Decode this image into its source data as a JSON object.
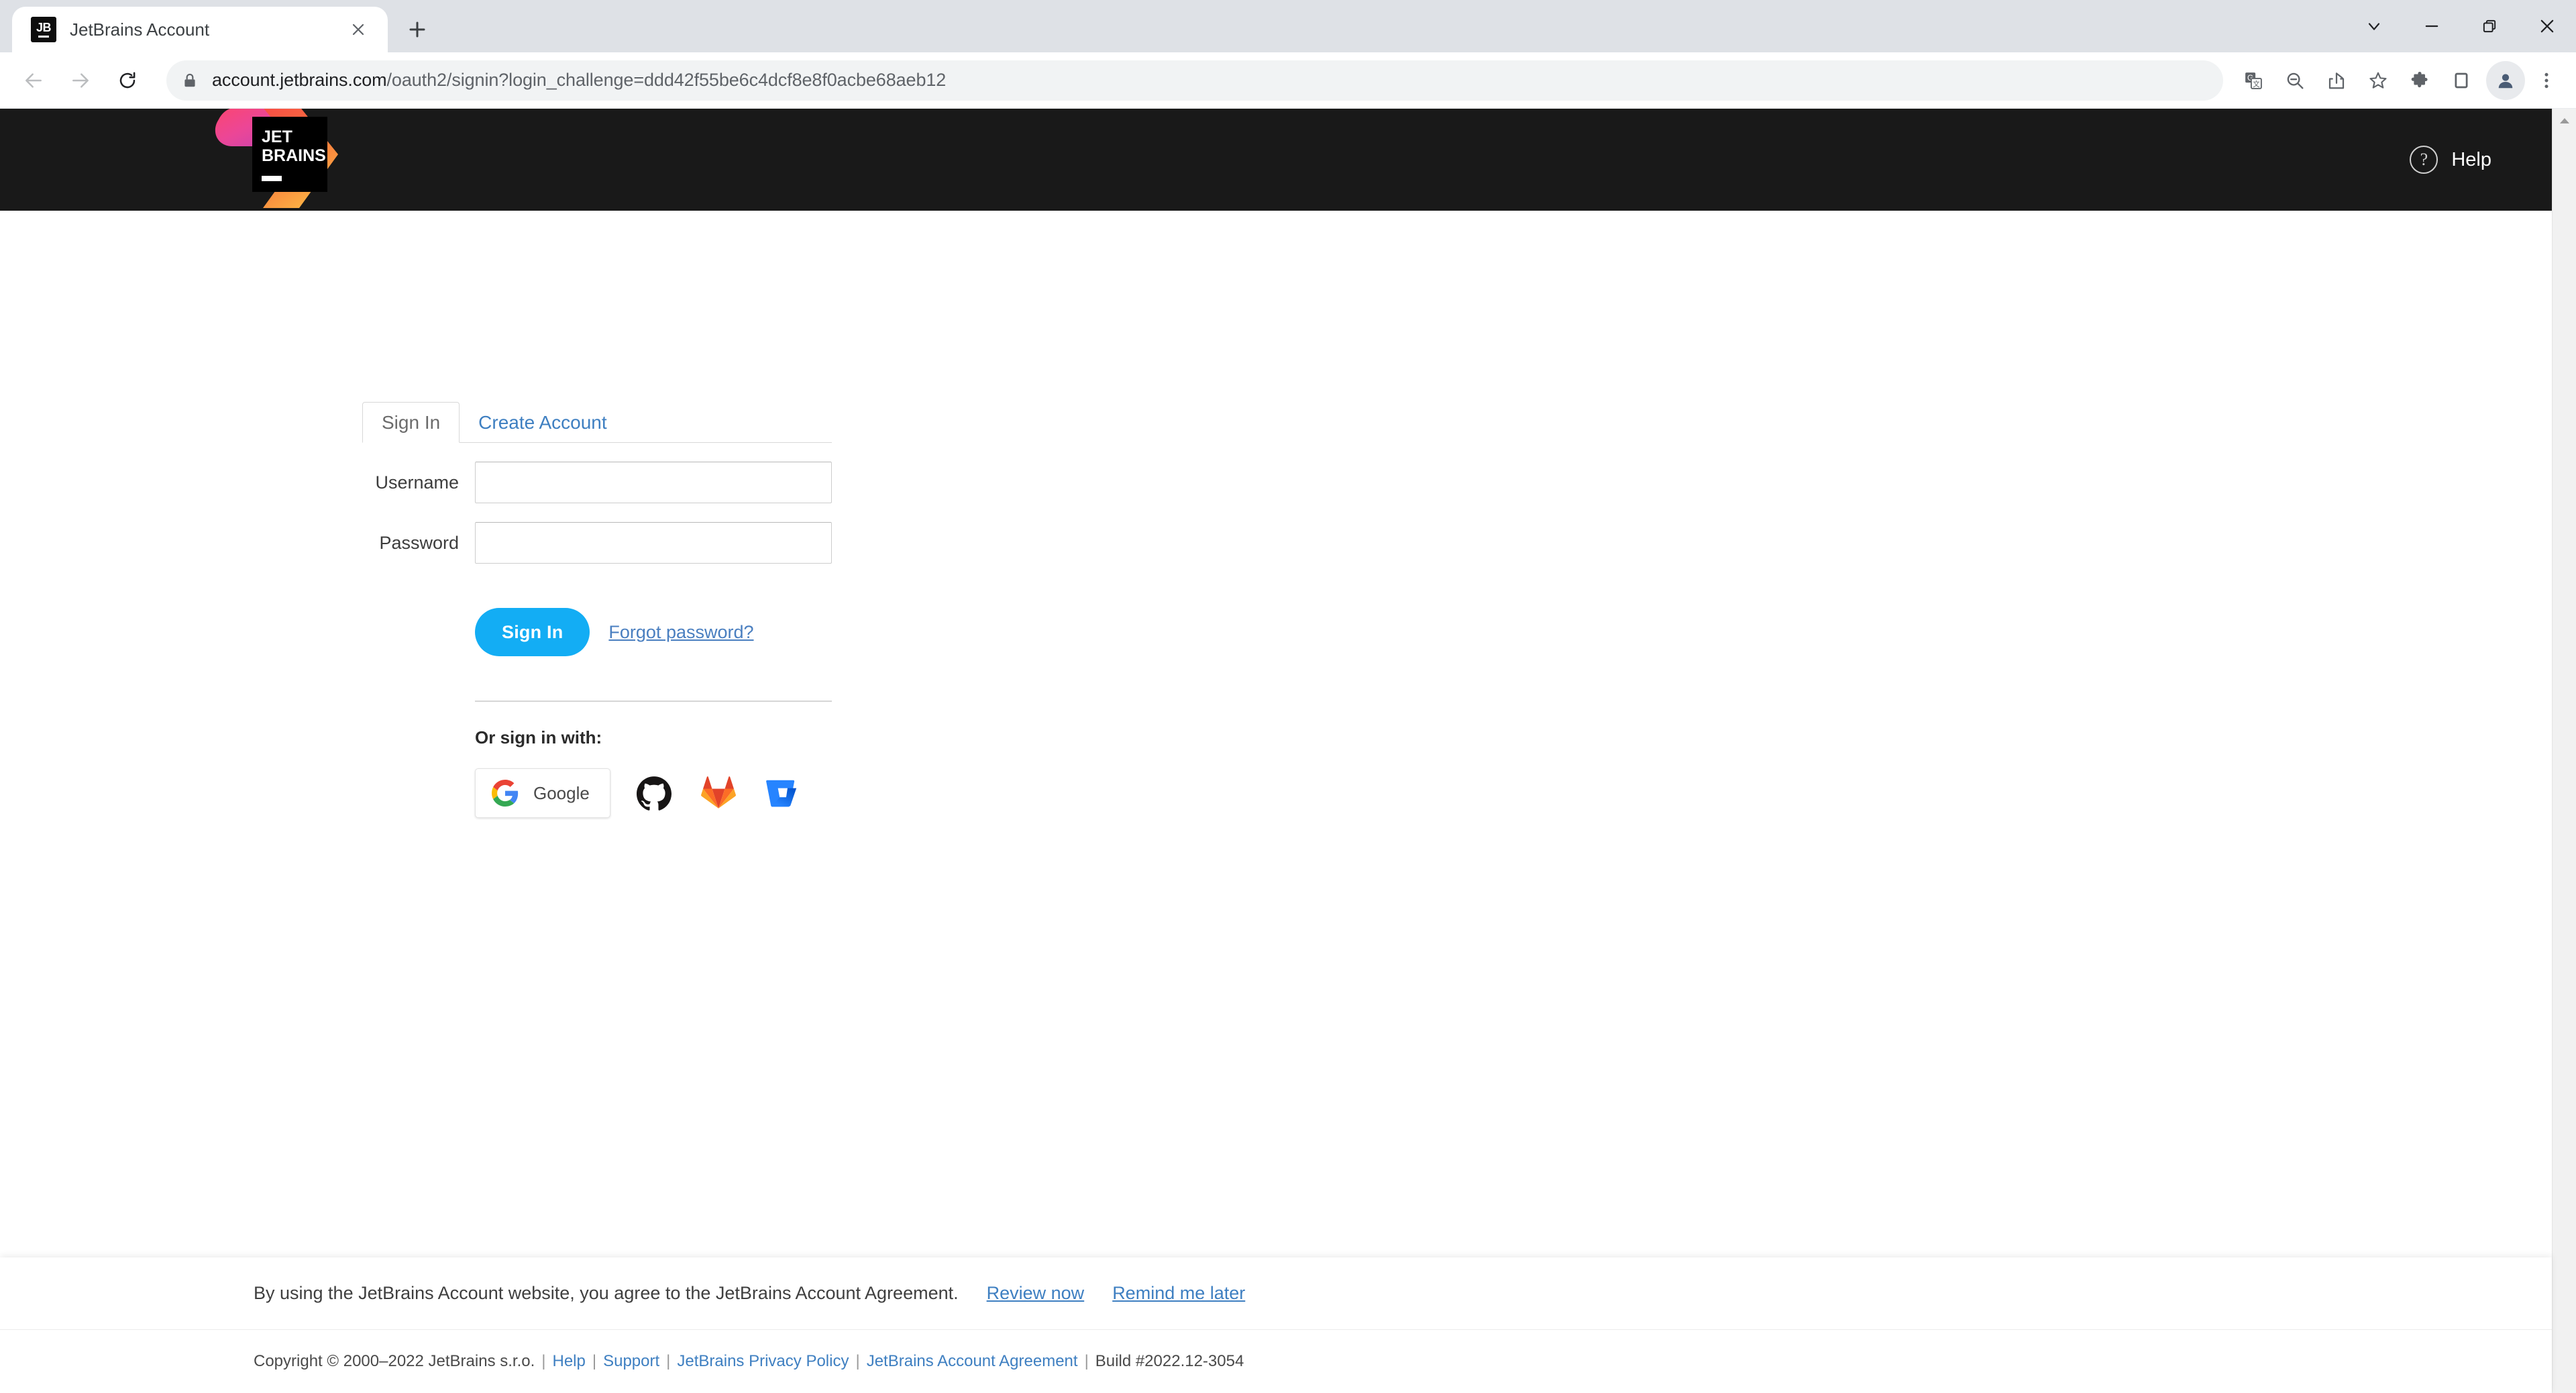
{
  "browser": {
    "tab": {
      "title": "JetBrains Account",
      "favicon_label": "JB",
      "close_icon": "close-icon"
    },
    "new_tab_icon": "plus-icon",
    "window_controls": [
      {
        "name": "tab-search-button",
        "icon": "chevron-down-icon"
      },
      {
        "name": "minimize-button",
        "icon": "minimize-icon"
      },
      {
        "name": "maximize-button",
        "icon": "restore-icon"
      },
      {
        "name": "close-window-button",
        "icon": "close-icon"
      }
    ],
    "nav": {
      "back_icon": "arrow-left-icon",
      "forward_icon": "arrow-right-icon",
      "reload_icon": "reload-icon"
    },
    "omnibox": {
      "lock_icon": "lock-icon",
      "url_domain": "account.jetbrains.com",
      "url_path": "/oauth2/signin?login_challenge=ddd42f55be6c4dcf8e8f0acbe68aeb12",
      "full_url": "account.jetbrains.com/oauth2/signin?login_challenge=ddd42f55be6c4dcf8e8f0acbe68aeb12"
    },
    "toolbar_icons": [
      {
        "name": "translate-icon"
      },
      {
        "name": "zoom-out-icon"
      },
      {
        "name": "share-icon"
      },
      {
        "name": "bookmark-star-icon"
      },
      {
        "name": "extensions-puzzle-icon"
      },
      {
        "name": "side-panel-icon"
      },
      {
        "name": "profile-avatar-icon"
      },
      {
        "name": "chrome-menu-icon"
      }
    ]
  },
  "site_header": {
    "logo_alt": "JetBrains",
    "logo_text_line1": "JET",
    "logo_text_line2": "BRAINS",
    "help_label": "Help",
    "help_icon": "question-circle-icon",
    "background": "#191919"
  },
  "signin": {
    "tabs": [
      {
        "label": "Sign In",
        "active": true
      },
      {
        "label": "Create Account",
        "active": false
      }
    ],
    "fields": [
      {
        "label": "Username",
        "value": "",
        "placeholder": ""
      },
      {
        "label": "Password",
        "value": "",
        "placeholder": ""
      }
    ],
    "submit_label": "Sign In",
    "forgot_label": "Forgot password?",
    "or_sign_in_with": "Or sign in with:",
    "providers": [
      {
        "name": "google",
        "label": "Google",
        "icon": "google-icon"
      },
      {
        "name": "github",
        "label": "",
        "icon": "github-icon"
      },
      {
        "name": "gitlab",
        "label": "",
        "icon": "gitlab-icon"
      },
      {
        "name": "bitbucket",
        "label": "",
        "icon": "bitbucket-icon"
      }
    ],
    "accent_color": "#13adf4",
    "link_color": "#3e7fc1"
  },
  "footer": {
    "agreement_text": "By using the JetBrains Account website, you agree to the JetBrains Account Agreement.",
    "review_label": "Review now",
    "remind_label": "Remind me later",
    "copyright": "Copyright © 2000–2022 JetBrains s.r.o.",
    "links": [
      {
        "label": "Help"
      },
      {
        "label": "Support"
      },
      {
        "label": "JetBrains Privacy Policy"
      },
      {
        "label": "JetBrains Account Agreement"
      }
    ],
    "build": "Build #2022.12-3054"
  }
}
